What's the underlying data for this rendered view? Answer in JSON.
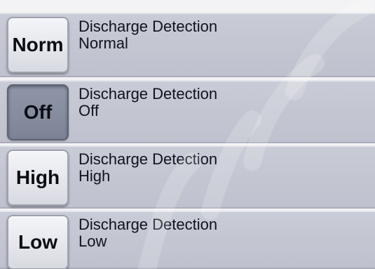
{
  "rows": [
    {
      "button": "Norm",
      "title": "Discharge Detection",
      "value": "Normal",
      "active": false
    },
    {
      "button": "Off",
      "title": "Discharge Detection",
      "value": "Off",
      "active": true
    },
    {
      "button": "High",
      "title": "Discharge Detection",
      "value": "High",
      "active": false
    },
    {
      "button": "Low",
      "title": "Discharge Detection",
      "value": "Low",
      "active": false
    }
  ],
  "colors": {
    "row_background": "#c4c7d2",
    "button_background": "#e6e7ec",
    "button_active_background": "#878ea0",
    "text": "#10131c",
    "page_background": "#f3f3f5"
  }
}
